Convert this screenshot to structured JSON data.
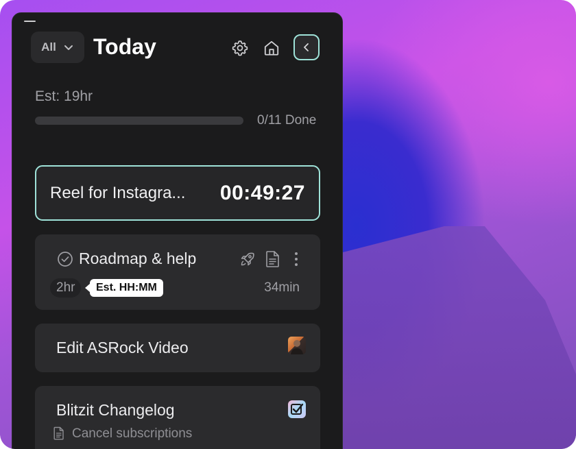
{
  "header": {
    "filter_label": "All",
    "title": "Today"
  },
  "summary": {
    "estimate": "Est: 19hr",
    "progress_fraction": 0,
    "done_text": "0/11 Done"
  },
  "active_task": {
    "title": "Reel for Instagra...",
    "timer": "00:49:27"
  },
  "tasks": [
    {
      "title": "Roadmap & help",
      "estimate_chip": "2hr",
      "tooltip": "Est. HH:MM",
      "time_spent": "34min",
      "icons": [
        "check-circle-icon",
        "rocket-icon",
        "document-icon",
        "kebab-menu-icon"
      ]
    },
    {
      "title": "Edit ASRock Video",
      "icons": [
        "avatar"
      ]
    },
    {
      "title": "Blitzit Changelog",
      "subtask": "Cancel subscriptions",
      "icons": [
        "checklist-app-icon",
        "document-icon"
      ]
    }
  ],
  "colors": {
    "accent": "#9fe3d9",
    "panel_bg": "#1b1b1c",
    "card_bg": "#2b2b2d"
  }
}
